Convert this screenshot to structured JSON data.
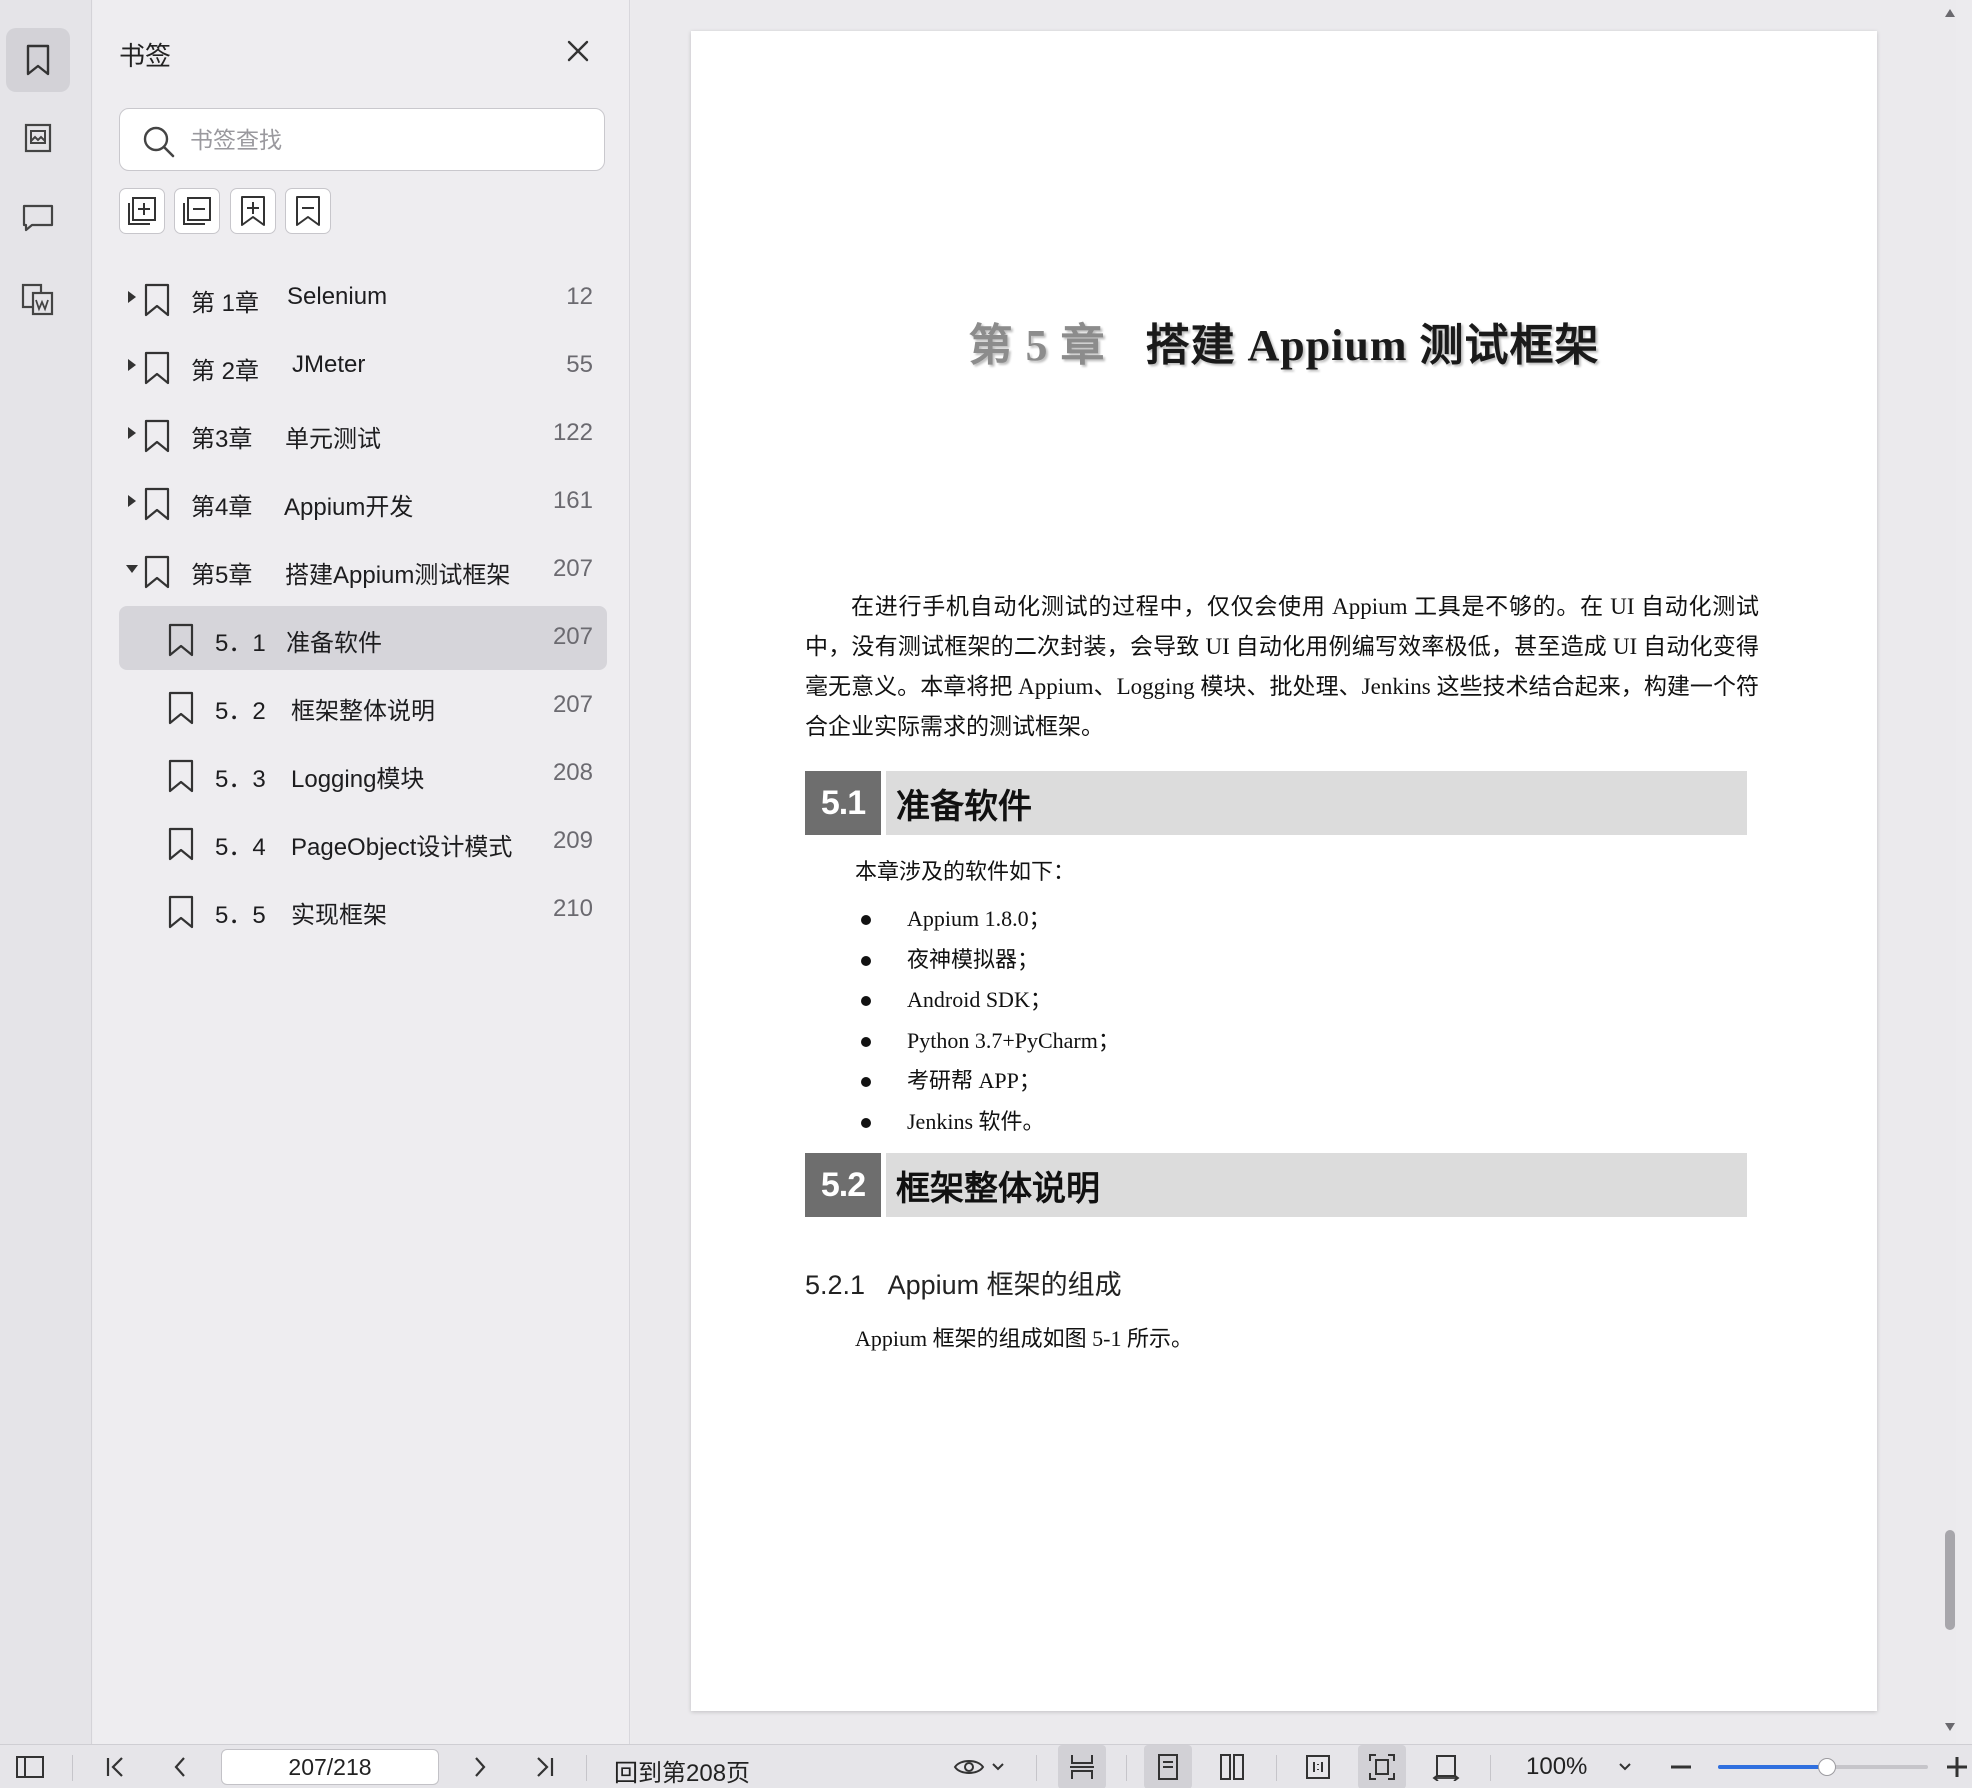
{
  "sidebar": {
    "title": "书签",
    "search_placeholder": "书签查找",
    "bookmarks": [
      {
        "chapter": "第 1章",
        "title": "Selenium",
        "page": "12"
      },
      {
        "chapter": "第 2章",
        "title": "JMeter",
        "page": "55"
      },
      {
        "chapter": "第3章",
        "title": "单元测试",
        "page": "122"
      },
      {
        "chapter": "第4章",
        "title": "Appium开发",
        "page": "161"
      },
      {
        "chapter": "第5章",
        "title": "搭建Appium测试框架",
        "page": "207"
      }
    ],
    "subitems": [
      {
        "num": "5．1",
        "title": "准备软件",
        "page": "207"
      },
      {
        "num": "5．2",
        "title": "框架整体说明",
        "page": "207"
      },
      {
        "num": "5．3",
        "title": "Logging模块",
        "page": "208"
      },
      {
        "num": "5．4",
        "title": "PageObject设计模式",
        "page": "209"
      },
      {
        "num": "5．5",
        "title": "实现框架",
        "page": "210"
      }
    ]
  },
  "document": {
    "chapter_num": "第 5 章",
    "chapter_title": "搭建 Appium 测试框架",
    "intro": "在进行手机自动化测试的过程中，仅仅会使用 Appium 工具是不够的。在 UI 自动化测试中，没有测试框架的二次封装，会导致 UI 自动化用例编写效率极低，甚至造成 UI 自动化变得毫无意义。本章将把 Appium、Logging 模块、批处理、Jenkins 这些技术结合起来，构建一个符合企业实际需求的测试框架。",
    "sec1_num": "5.1",
    "sec1_title": "准备软件",
    "sec1_lead": "本章涉及的软件如下：",
    "software": [
      "Appium 1.8.0；",
      "夜神模拟器；",
      "Android SDK；",
      "Python 3.7+PyCharm；",
      "考研帮 APP；",
      "Jenkins 软件。"
    ],
    "sec2_num": "5.2",
    "sec2_title": "框架整体说明",
    "sub_num": "5.2.1",
    "sub_title": "Appium 框架的组成",
    "sub_text": "Appium 框架的组成如图 5-1 所示。"
  },
  "bottombar": {
    "page_field": "207/218",
    "back_link": "回到第208页",
    "zoom": "100%",
    "zoom_slider_level": 0.52
  },
  "colors": {
    "accent": "#2f6fdf",
    "section_num_bg": "#6e6e6e",
    "section_bar_bg": "#dcdcdc",
    "selected_row": "#d6d5da"
  }
}
